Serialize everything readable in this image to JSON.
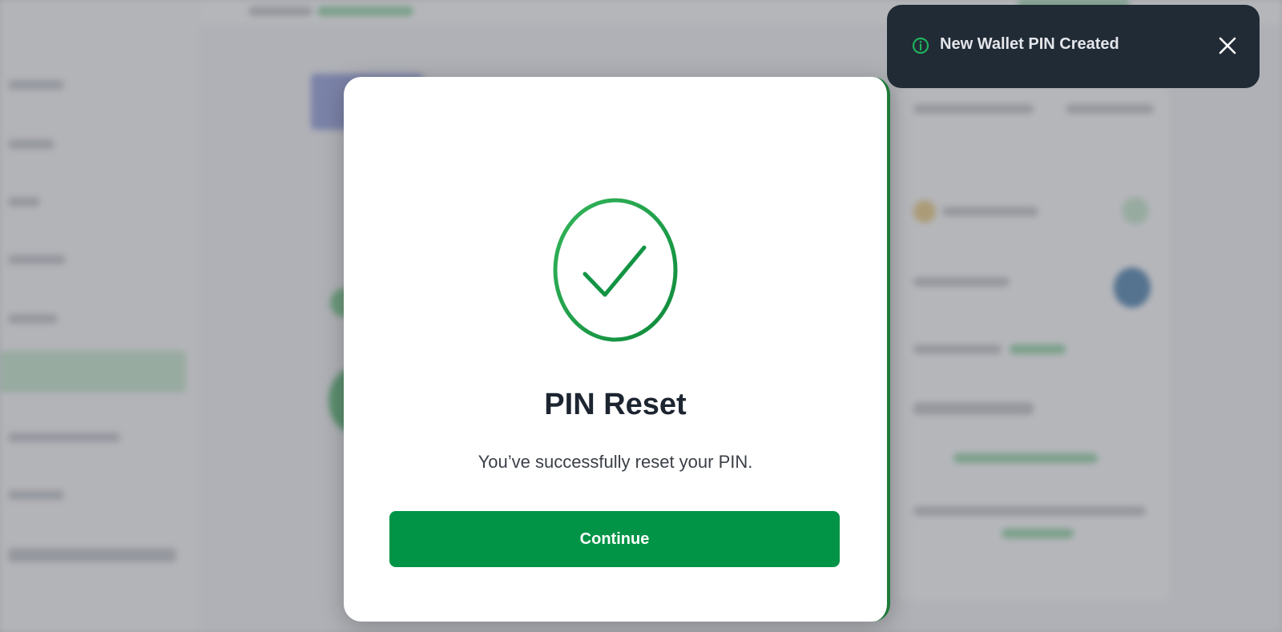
{
  "modal": {
    "title": "PIN Reset",
    "message": "You’ve successfully reset your PIN.",
    "continue_label": "Continue",
    "icon": "check-circle-icon"
  },
  "toast": {
    "message": "New Wallet PIN Created",
    "icon": "info-icon",
    "close_icon": "close-icon"
  },
  "colors": {
    "primary_green": "#029446",
    "toast_background": "#212b36",
    "title_text": "#1c2530"
  }
}
